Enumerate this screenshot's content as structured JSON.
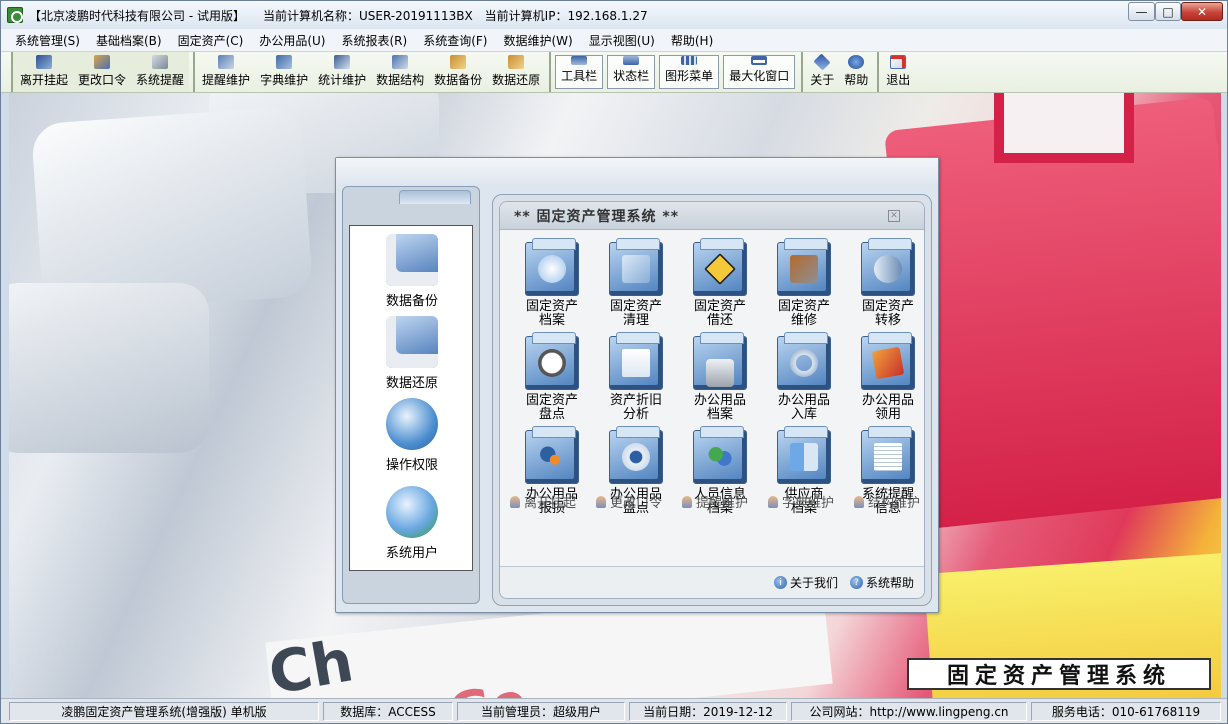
{
  "titlebar": {
    "company": "【北京凌鹏时代科技有限公司 - 试用版】",
    "machine": "当前计算机名称：USER-20191113BX",
    "ip": "当前计算机IP：192.168.1.27",
    "min": "—",
    "max": "□",
    "close": "✕"
  },
  "menu": [
    "系统管理(S)",
    "基础档案(B)",
    "固定资产(C)",
    "办公用品(U)",
    "系统报表(R)",
    "系统查询(F)",
    "数据维护(W)",
    "显示视图(U)",
    "帮助(H)"
  ],
  "toolbar": {
    "group1": [
      "离开挂起",
      "更改口令",
      "系统提醒"
    ],
    "group2": [
      "提醒维护",
      "字典维护",
      "统计维护",
      "数据结构",
      "数据备份",
      "数据还原"
    ],
    "group3": [
      "工具栏",
      "状态栏",
      "图形菜单",
      "最大化窗口"
    ],
    "group4": [
      "关于",
      "帮助"
    ],
    "group5": [
      "退出"
    ]
  },
  "desktop": {
    "brand": "固定资产管理系统"
  },
  "left_panel": {
    "items": [
      "数据备份",
      "数据还原",
      "操作权限",
      "系统用户"
    ]
  },
  "main_panel": {
    "title": "**  固定资产管理系统  **",
    "grid": [
      "固定资产\n档案",
      "固定资产\n清理",
      "固定资产\n借还",
      "固定资产\n维修",
      "固定资产\n转移",
      "固定资产\n盘点",
      "资产折旧\n分析",
      "办公用品\n档案",
      "办公用品\n入库",
      "办公用品\n领用",
      "办公用品\n报损",
      "办公用品\n盘点",
      "人员信息\n档案",
      "供应商\n档案",
      "系统提醒\n信息"
    ],
    "quick": [
      "离开挂起",
      "更改口令",
      "提醒维护",
      "字典维护",
      "结构维护"
    ],
    "footer": [
      "关于我们",
      "系统帮助"
    ]
  },
  "statusbar": {
    "product": "凌鹏固定资产管理系统(增强版) 单机版",
    "db": "数据库：ACCESS",
    "admin": "当前管理员：超级用户",
    "date": "当前日期：2019-12-12",
    "website": "公司网站：http://www.lingpeng.cn",
    "phone": "服务电话：010-61768119"
  }
}
